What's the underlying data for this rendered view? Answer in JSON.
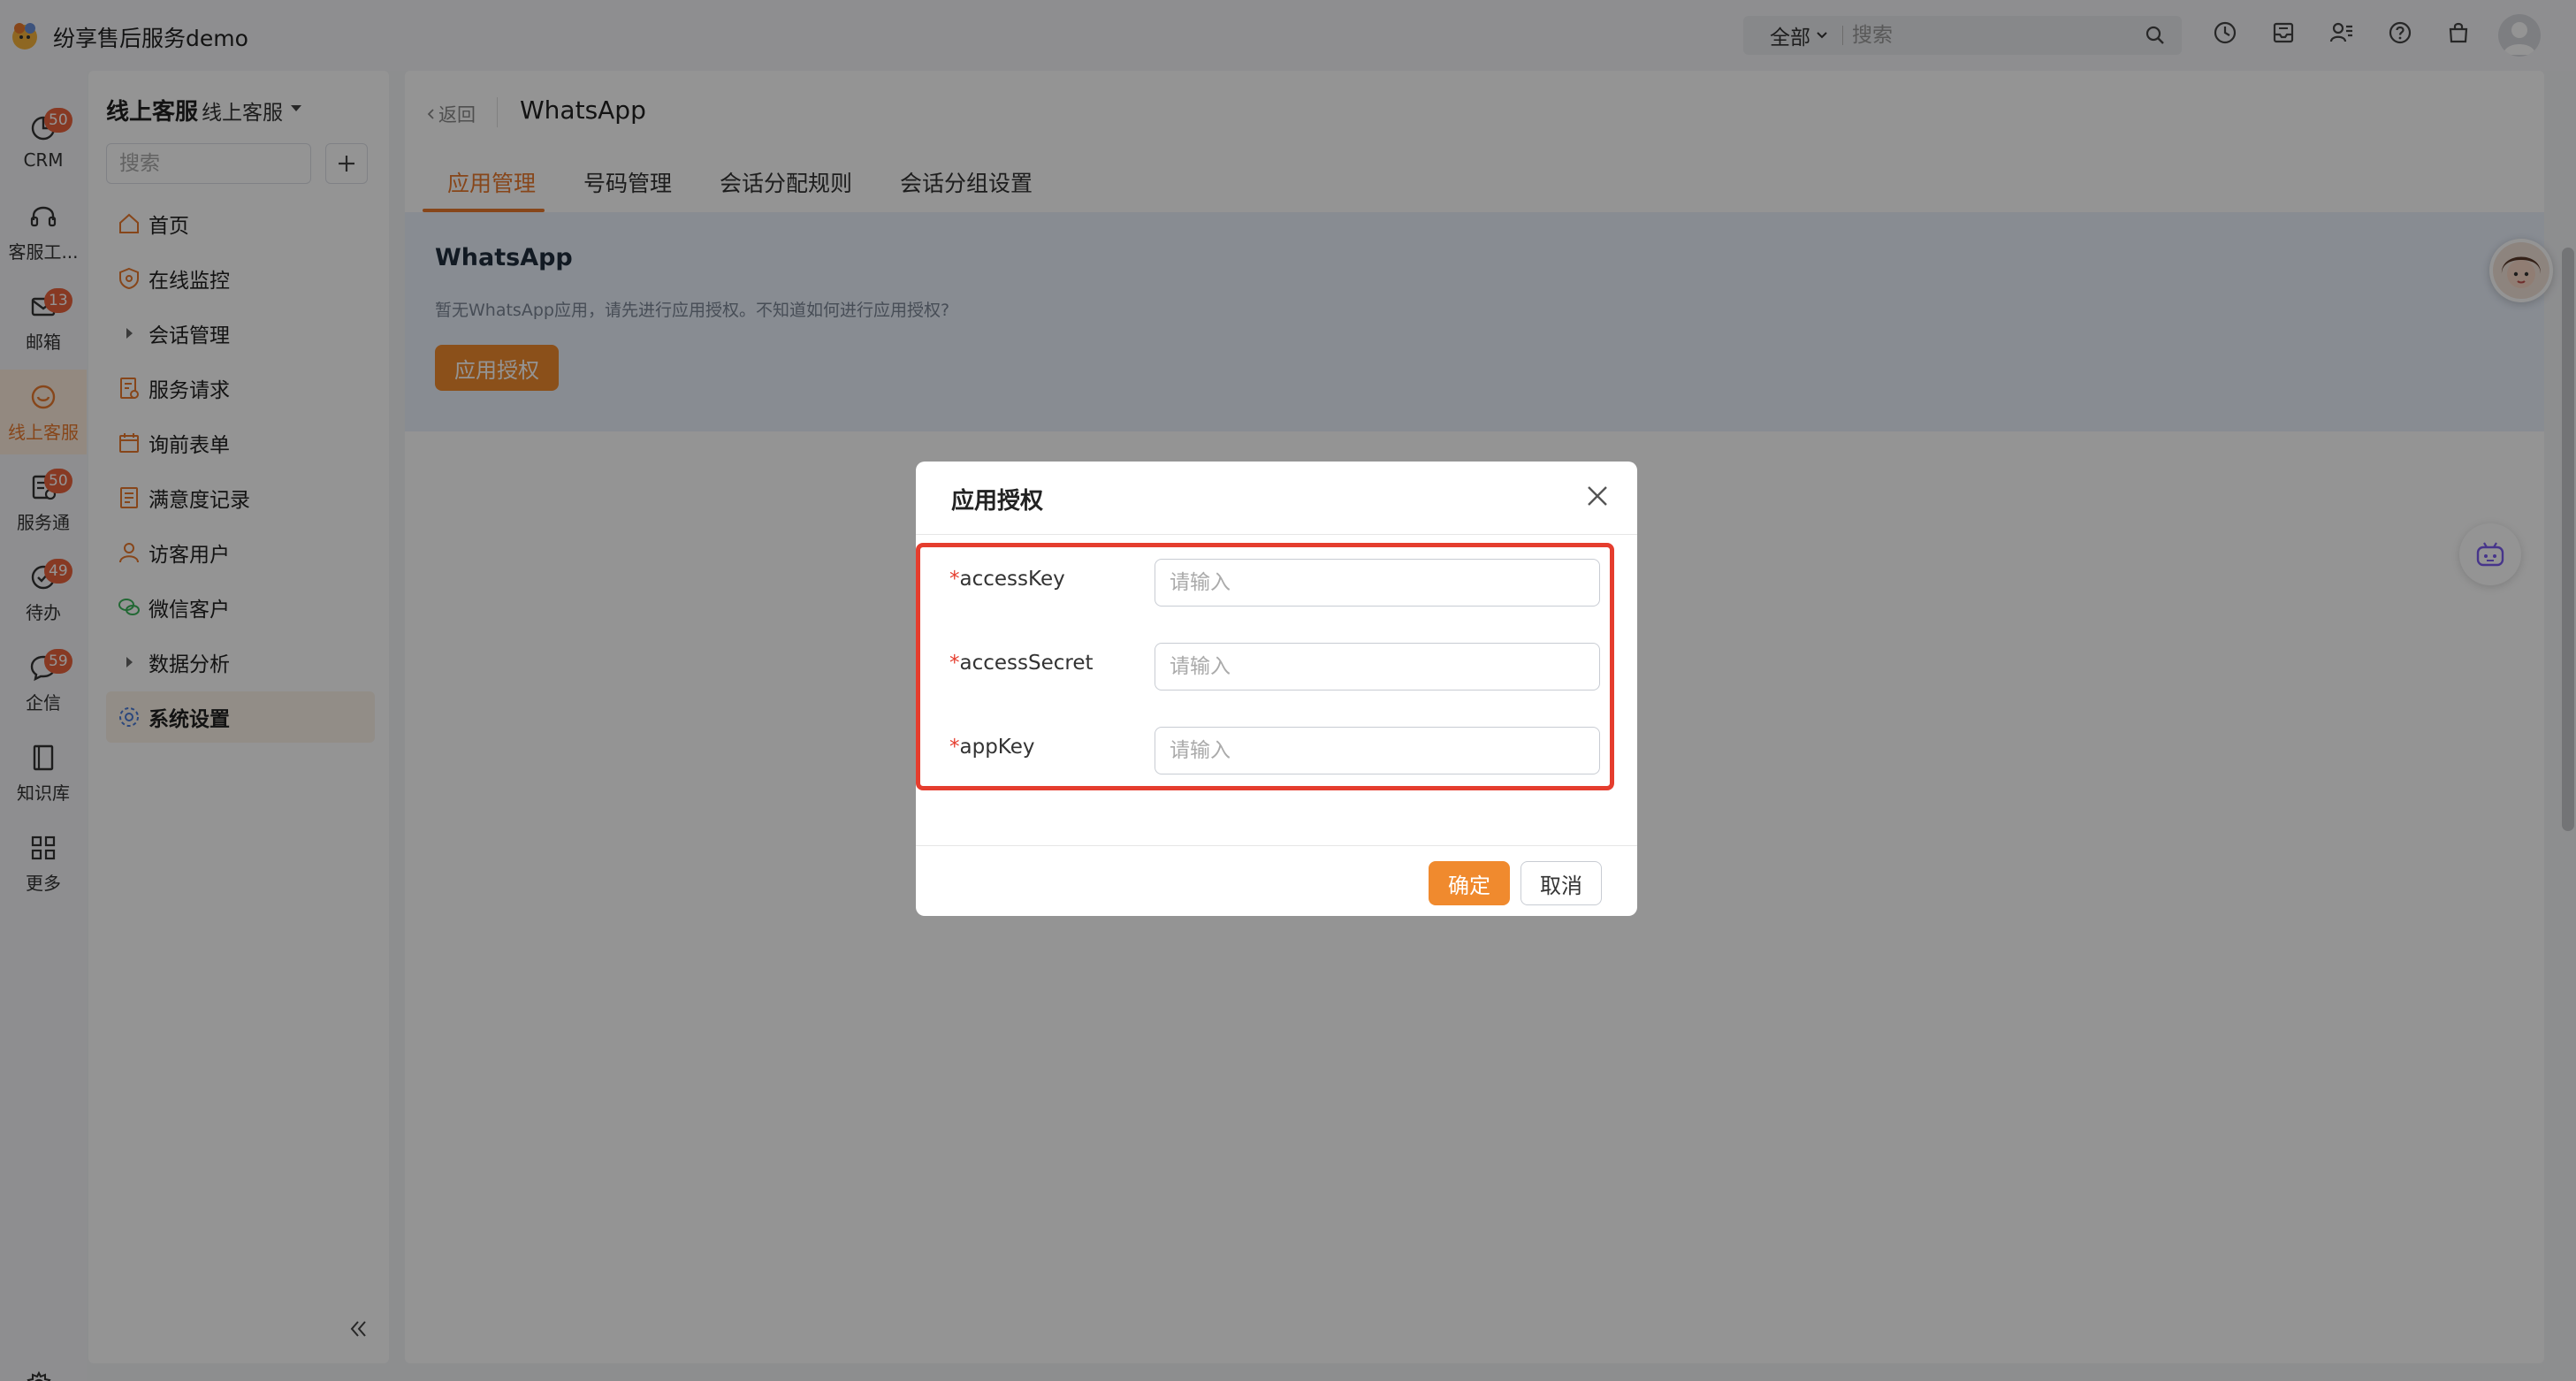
{
  "app": {
    "title": "纷享售后服务demo",
    "accent_color": "#f08a2e"
  },
  "topbar": {
    "scope_label": "全部",
    "search_placeholder": "搜索",
    "icons": [
      "clock-icon",
      "inbox-icon",
      "contacts-icon",
      "help-icon",
      "bag-icon"
    ]
  },
  "rail": {
    "items": [
      {
        "label": "CRM",
        "badge": "50",
        "icon": "pie-chart-icon"
      },
      {
        "label": "客服工...",
        "badge": "",
        "icon": "headset-icon"
      },
      {
        "label": "邮箱",
        "badge": "13",
        "icon": "mail-icon"
      },
      {
        "label": "线上客服",
        "badge": "",
        "icon": "smile-chat-icon"
      },
      {
        "label": "服务通",
        "badge": "50",
        "icon": "service-icon"
      },
      {
        "label": "待办",
        "badge": "49",
        "icon": "check-circle-icon"
      },
      {
        "label": "企信",
        "badge": "59",
        "icon": "chat-bubble-icon"
      },
      {
        "label": "知识库",
        "badge": "",
        "icon": "book-icon"
      },
      {
        "label": "更多",
        "badge": "",
        "icon": "grid-icon"
      }
    ]
  },
  "sidebar": {
    "title": "线上客服",
    "subtitle": "线上客服",
    "search_placeholder": "搜索",
    "items": [
      {
        "label": "首页",
        "icon": "home-icon"
      },
      {
        "label": "在线监控",
        "icon": "monitor-shield-icon"
      },
      {
        "label": "会话管理",
        "icon": "caret-right-icon"
      },
      {
        "label": "服务请求",
        "icon": "request-doc-icon"
      },
      {
        "label": "询前表单",
        "icon": "calendar-form-icon"
      },
      {
        "label": "满意度记录",
        "icon": "doc-list-icon"
      },
      {
        "label": "访客用户",
        "icon": "user-icon"
      },
      {
        "label": "微信客户",
        "icon": "wechat-icon"
      },
      {
        "label": "数据分析",
        "icon": "caret-right-icon"
      },
      {
        "label": "系统设置",
        "icon": "settings-gear-icon"
      }
    ]
  },
  "main": {
    "back_label": "返回",
    "page_title": "WhatsApp",
    "tabs": [
      "应用管理",
      "号码管理",
      "会话分配规则",
      "会话分组设置"
    ],
    "panel": {
      "title": "WhatsApp",
      "description": "暂无WhatsApp应用，请先进行应用授权。不知道如何进行应用授权?",
      "button_label": "应用授权"
    }
  },
  "modal": {
    "title": "应用授权",
    "fields": [
      {
        "required_mark": "*",
        "label": "accessKey",
        "placeholder": "请输入",
        "value": ""
      },
      {
        "required_mark": "*",
        "label": "accessSecret",
        "placeholder": "请输入",
        "value": ""
      },
      {
        "required_mark": "*",
        "label": "appKey",
        "placeholder": "请输入",
        "value": ""
      }
    ],
    "ok_label": "确定",
    "cancel_label": "取消",
    "highlight_color": "#e53d2e"
  }
}
